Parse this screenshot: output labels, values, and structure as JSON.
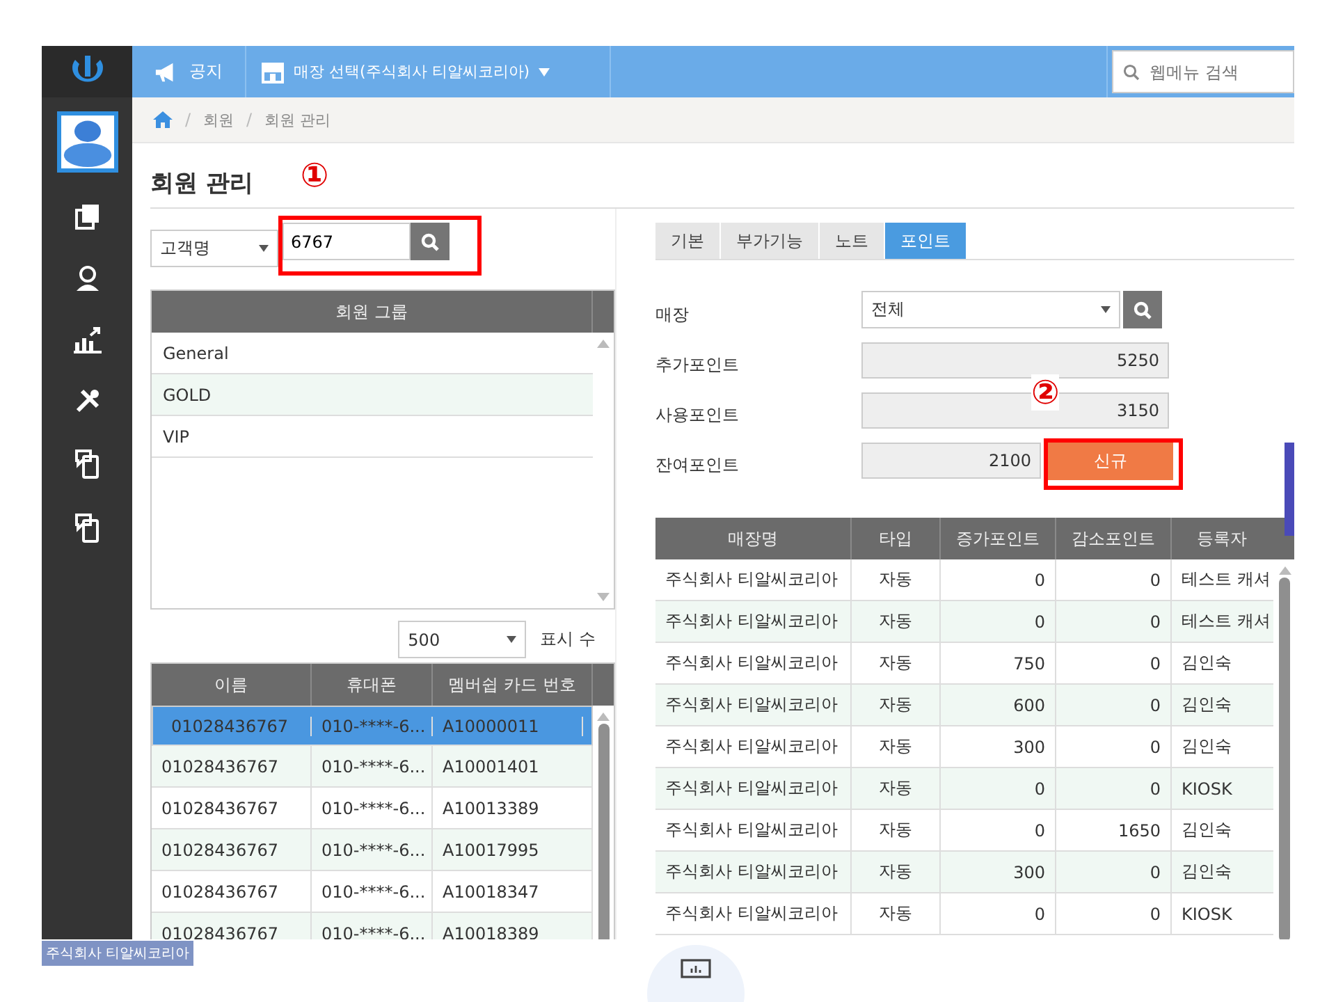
{
  "top_bar": {
    "notice": "공지",
    "store_selector": "매장 선택(주식회사 티알씨코리아)",
    "search": {
      "placeholder": "웹메뉴 검색"
    }
  },
  "breadcrumb": [
    {
      "kind": "separator",
      "text": "/"
    },
    {
      "kind": "link",
      "text": "회원"
    },
    {
      "kind": "separator",
      "text": "/"
    },
    {
      "kind": "link",
      "text": "회원 관리"
    }
  ],
  "page_title": "회원 관리",
  "annotations": [
    {
      "label": "①"
    },
    {
      "label": "②"
    }
  ],
  "filter": {
    "field": "고객명",
    "value": "6767"
  },
  "group_table": {
    "header": "회원 그룹",
    "rows": [
      {
        "name": "General"
      },
      {
        "name": "GOLD"
      },
      {
        "name": "VIP"
      }
    ]
  },
  "page_size": {
    "value": "500",
    "label": "표시 수"
  },
  "member_table": {
    "columns": [
      "이름",
      "휴대폰",
      "멤버쉽 카드 번호"
    ],
    "rows": [
      {
        "cells": [
          "01028436767",
          "010-****-6...",
          "A10000011"
        ],
        "selected": true
      },
      {
        "cells": [
          "01028436767",
          "010-****-6...",
          "A10001401"
        ],
        "selected": false
      },
      {
        "cells": [
          "01028436767",
          "010-****-6...",
          "A10013389"
        ],
        "selected": false
      },
      {
        "cells": [
          "01028436767",
          "010-****-6...",
          "A10017995"
        ],
        "selected": false
      },
      {
        "cells": [
          "01028436767",
          "010-****-6...",
          "A10018347"
        ],
        "selected": false
      },
      {
        "cells": [
          "01028436767",
          "010-****-6...",
          "A10018389"
        ],
        "selected": false
      }
    ]
  },
  "tabs": [
    {
      "label": "기본",
      "selected": false
    },
    {
      "label": "부가기능",
      "selected": false
    },
    {
      "label": "노트",
      "selected": false
    },
    {
      "label": "포인트",
      "selected": true
    }
  ],
  "point_form": {
    "store_label": "매장",
    "store_value": "전체",
    "added_label": "추가포인트",
    "added": "5250",
    "used_label": "사용포인트",
    "used": "3150",
    "remaining_label": "잔여포인트",
    "remaining": "2100",
    "new_button": "신규"
  },
  "point_table": {
    "columns": [
      "매장명",
      "타입",
      "증가포인트",
      "감소포인트",
      "등록자"
    ],
    "rows": [
      [
        "주식회사 티알씨코리아",
        "자동",
        "0",
        "0",
        "테스트 캐셔"
      ],
      [
        "주식회사 티알씨코리아",
        "자동",
        "0",
        "0",
        "테스트 캐셔"
      ],
      [
        "주식회사 티알씨코리아",
        "자동",
        "750",
        "0",
        "김인숙"
      ],
      [
        "주식회사 티알씨코리아",
        "자동",
        "600",
        "0",
        "김인숙"
      ],
      [
        "주식회사 티알씨코리아",
        "자동",
        "300",
        "0",
        "김인숙"
      ],
      [
        "주식회사 티알씨코리아",
        "자동",
        "0",
        "0",
        "KIOSK"
      ],
      [
        "주식회사 티알씨코리아",
        "자동",
        "0",
        "1650",
        "김인숙"
      ],
      [
        "주식회사 티알씨코리아",
        "자동",
        "300",
        "0",
        "김인숙"
      ],
      [
        "주식회사 티알씨코리아",
        "자동",
        "0",
        "0",
        "KIOSK"
      ]
    ]
  },
  "tooltip": "주식회사 티알씨코리아"
}
